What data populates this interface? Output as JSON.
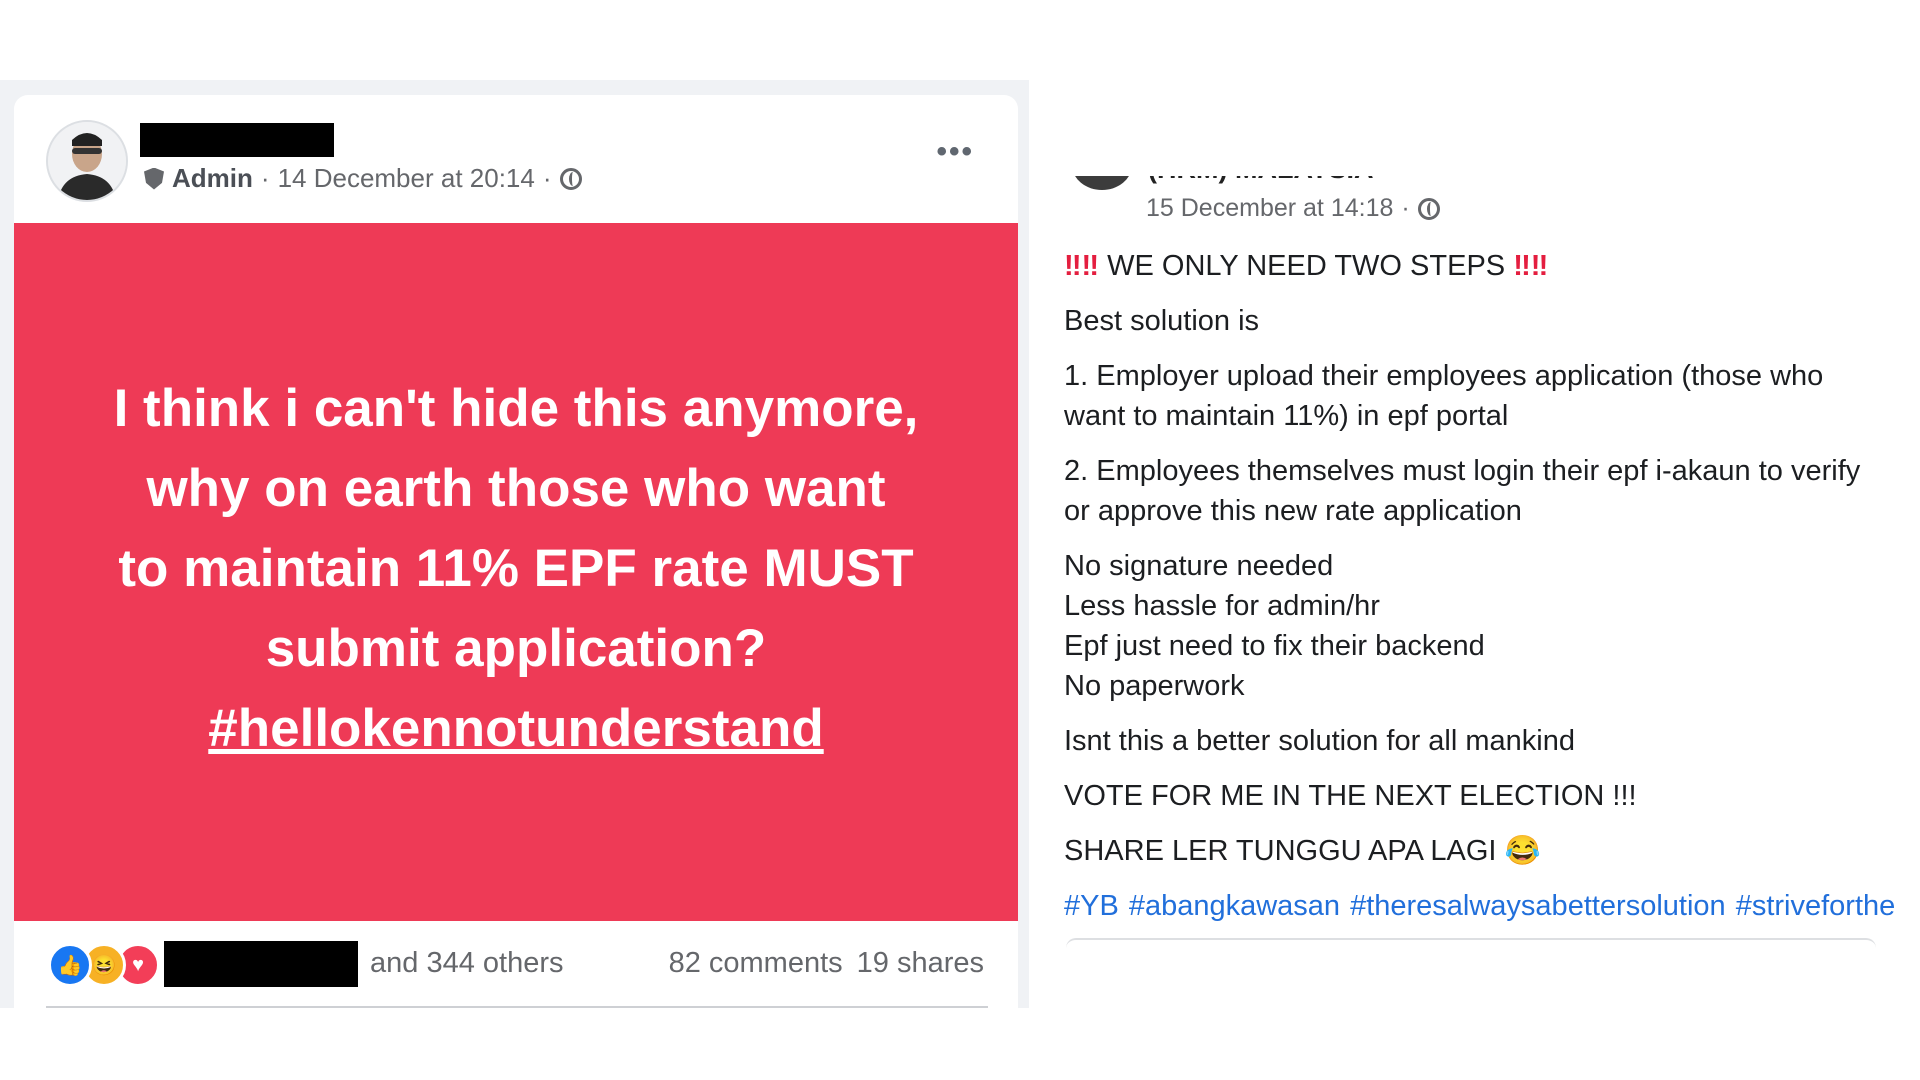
{
  "left_post": {
    "role": "Admin",
    "date": "14 December at 20:14",
    "separator": "·",
    "more_label": "•••",
    "banner": {
      "lines": [
        "I think i can't hide this anymore,",
        "why on earth those who want",
        "to maintain 11% EPF rate MUST",
        "submit application?"
      ],
      "hashtag": "#hellokennotunderstand"
    },
    "reactions": [
      "like",
      "haha",
      "love"
    ],
    "others": "and 344 others",
    "comments": "82 comments",
    "shares": "19 shares"
  },
  "right_post": {
    "name_partial": "(HRM) MALAYSIA",
    "date": "15 December at 14:18",
    "separator": "·",
    "heading_marks": "‼‼",
    "heading": "WE ONLY NEED TWO STEPS",
    "line_best": "Best solution is",
    "step1": "1. Employer upload their employees application  (those who want to maintain 11%) in epf portal",
    "step2": "2. Employees themselves must login their epf i-akaun to verify or approve this new rate application",
    "benefits": [
      "No signature needed",
      "Less hassle for admin/hr",
      "Epf just need to fix their backend",
      "No paperwork"
    ],
    "question": "Isnt this a better solution for all mankind",
    "vote": "VOTE FOR ME IN THE NEXT ELECTION !!!",
    "share": "SHARE LER TUNGGU APA LAGI",
    "share_emoji": "😂",
    "hashtags": [
      "#YB",
      "#abangkawasan",
      "#theresalwaysabettersolution",
      "#striveforthebest"
    ]
  },
  "colors": {
    "banner_red": "#ee3a56",
    "link_blue": "#216fdb",
    "meta_grey": "#65676b"
  }
}
